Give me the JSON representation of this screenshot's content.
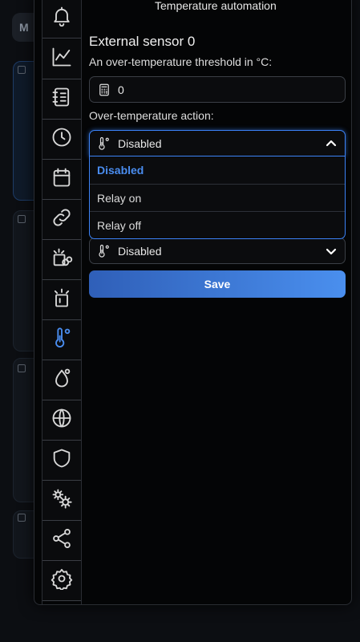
{
  "background": {
    "app_badge": "M"
  },
  "modal": {
    "title": "Temperature automation",
    "sensor_title": "External sensor 0",
    "threshold_label": "An over-temperature threshold in °C:",
    "threshold_value": "0",
    "action_label": "Over-temperature action:",
    "action_value": "Disabled",
    "action_options": [
      "Disabled",
      "Relay on",
      "Relay off"
    ],
    "second_select_value": "Disabled",
    "save_label": "Save"
  },
  "sidebar": {
    "items": [
      {
        "icon": "bell-icon"
      },
      {
        "icon": "chart-icon"
      },
      {
        "icon": "notebook-icon"
      },
      {
        "icon": "clock-icon"
      },
      {
        "icon": "calendar-icon"
      },
      {
        "icon": "link-icon"
      },
      {
        "icon": "relay-link-icon"
      },
      {
        "icon": "relay-icon"
      },
      {
        "icon": "thermometer-icon",
        "active": true
      },
      {
        "icon": "droplet-icon"
      },
      {
        "icon": "globe-icon"
      },
      {
        "icon": "shield-icon"
      },
      {
        "icon": "gears-icon"
      },
      {
        "icon": "share-icon"
      },
      {
        "icon": "settings-icon"
      }
    ]
  },
  "colors": {
    "accent": "#4a8df0",
    "border": "#3b3f46",
    "background": "#040506"
  }
}
